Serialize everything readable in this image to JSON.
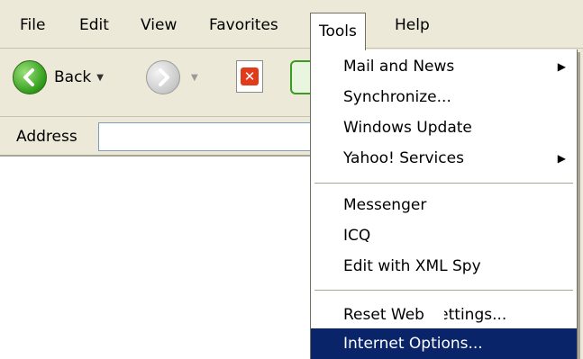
{
  "menubar": {
    "items": [
      {
        "label": "File"
      },
      {
        "label": "Edit"
      },
      {
        "label": "View"
      },
      {
        "label": "Favorites"
      },
      {
        "label": "Tools"
      },
      {
        "label": "Help"
      }
    ]
  },
  "toolbar": {
    "back_label": "Back"
  },
  "address": {
    "label": "Address",
    "value": ""
  },
  "tools_menu": {
    "groups": [
      [
        {
          "label": "Mail and News",
          "submenu": true
        },
        {
          "label": "Synchronize...",
          "submenu": false
        },
        {
          "label": "Windows Update",
          "submenu": false
        },
        {
          "label": "Yahoo! Services",
          "submenu": true
        }
      ],
      [
        {
          "label": "Messenger",
          "submenu": false
        },
        {
          "label": "ICQ",
          "submenu": false
        },
        {
          "label": "Edit with XML Spy",
          "submenu": false
        }
      ],
      [
        {
          "label": "Reset Web Settings...",
          "submenu": false
        },
        {
          "label": "Internet Options...",
          "submenu": false,
          "selected": true
        }
      ]
    ],
    "submenu_arrow": "▶"
  },
  "colors": {
    "chrome": "#ece9d8",
    "selection": "#0a246a",
    "back_button": "#2f9a18"
  }
}
